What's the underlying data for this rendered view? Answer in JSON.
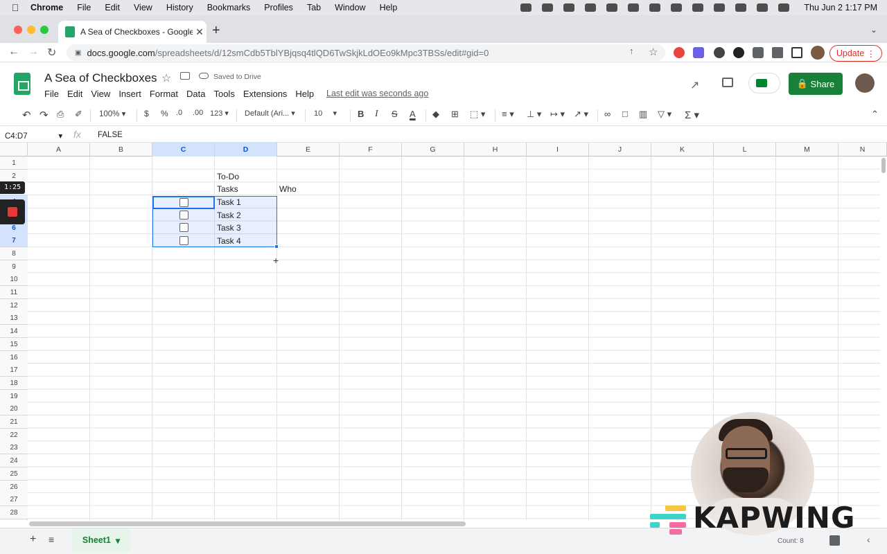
{
  "mac_menubar": {
    "app": "Chrome",
    "items": [
      "File",
      "Edit",
      "View",
      "History",
      "Bookmarks",
      "Profiles",
      "Tab",
      "Window",
      "Help"
    ],
    "clock": "Thu Jun 2  1:17 PM"
  },
  "browser": {
    "tab_title": "A Sea of Checkboxes - Google",
    "url_host": "docs.google.com",
    "url_path": "/spreadsheets/d/12smCdb5TblYBjqsq4tlQD6TwSkjkLdOEo9kMpc3TBSs/edit#gid=0",
    "update_label": "Update"
  },
  "doc": {
    "title": "A Sea of Checkboxes",
    "saved_status": "Saved to Drive",
    "menu": [
      "File",
      "Edit",
      "View",
      "Insert",
      "Format",
      "Data",
      "Tools",
      "Extensions",
      "Help"
    ],
    "last_edit": "Last edit was seconds ago",
    "share_label": "Share"
  },
  "toolbar": {
    "zoom": "100%",
    "currency": "$",
    "percent": "%",
    "dec_less": ".0",
    "dec_more": ".00",
    "number_format": "123",
    "font": "Default (Ari...",
    "font_size": "10"
  },
  "formula_bar": {
    "name_box": "C4:D7",
    "fx": "fx",
    "value": "FALSE"
  },
  "grid": {
    "columns": [
      "A",
      "B",
      "C",
      "D",
      "E",
      "F",
      "G",
      "H",
      "I",
      "J",
      "K",
      "L",
      "M",
      "N"
    ],
    "rows": [
      "1",
      "2",
      "3",
      "4",
      "5",
      "6",
      "7",
      "8",
      "9",
      "10",
      "11",
      "12",
      "13",
      "14",
      "15",
      "16",
      "17",
      "18",
      "19",
      "20",
      "21",
      "22",
      "23",
      "24",
      "25",
      "26",
      "27",
      "28"
    ],
    "cells": {
      "D2": "To-Do",
      "D3": "Tasks",
      "E3": "Who",
      "D4": "Task 1",
      "D5": "Task 2",
      "D6": "Task 3",
      "D7": "Task 4"
    },
    "checkboxes_checked": [
      false,
      false,
      false,
      false
    ]
  },
  "recording": {
    "time": "1:25"
  },
  "sheets": {
    "active": "Sheet1",
    "count_label": "Count: 8"
  },
  "watermark": "KAPWING",
  "colors": {
    "selection": "#1a73e8",
    "share_green": "#188038",
    "update_red": "#d93025",
    "kapwing_teal": "#3ed5c7",
    "kapwing_yellow": "#f9c440",
    "kapwing_pink": "#f56ca5"
  }
}
